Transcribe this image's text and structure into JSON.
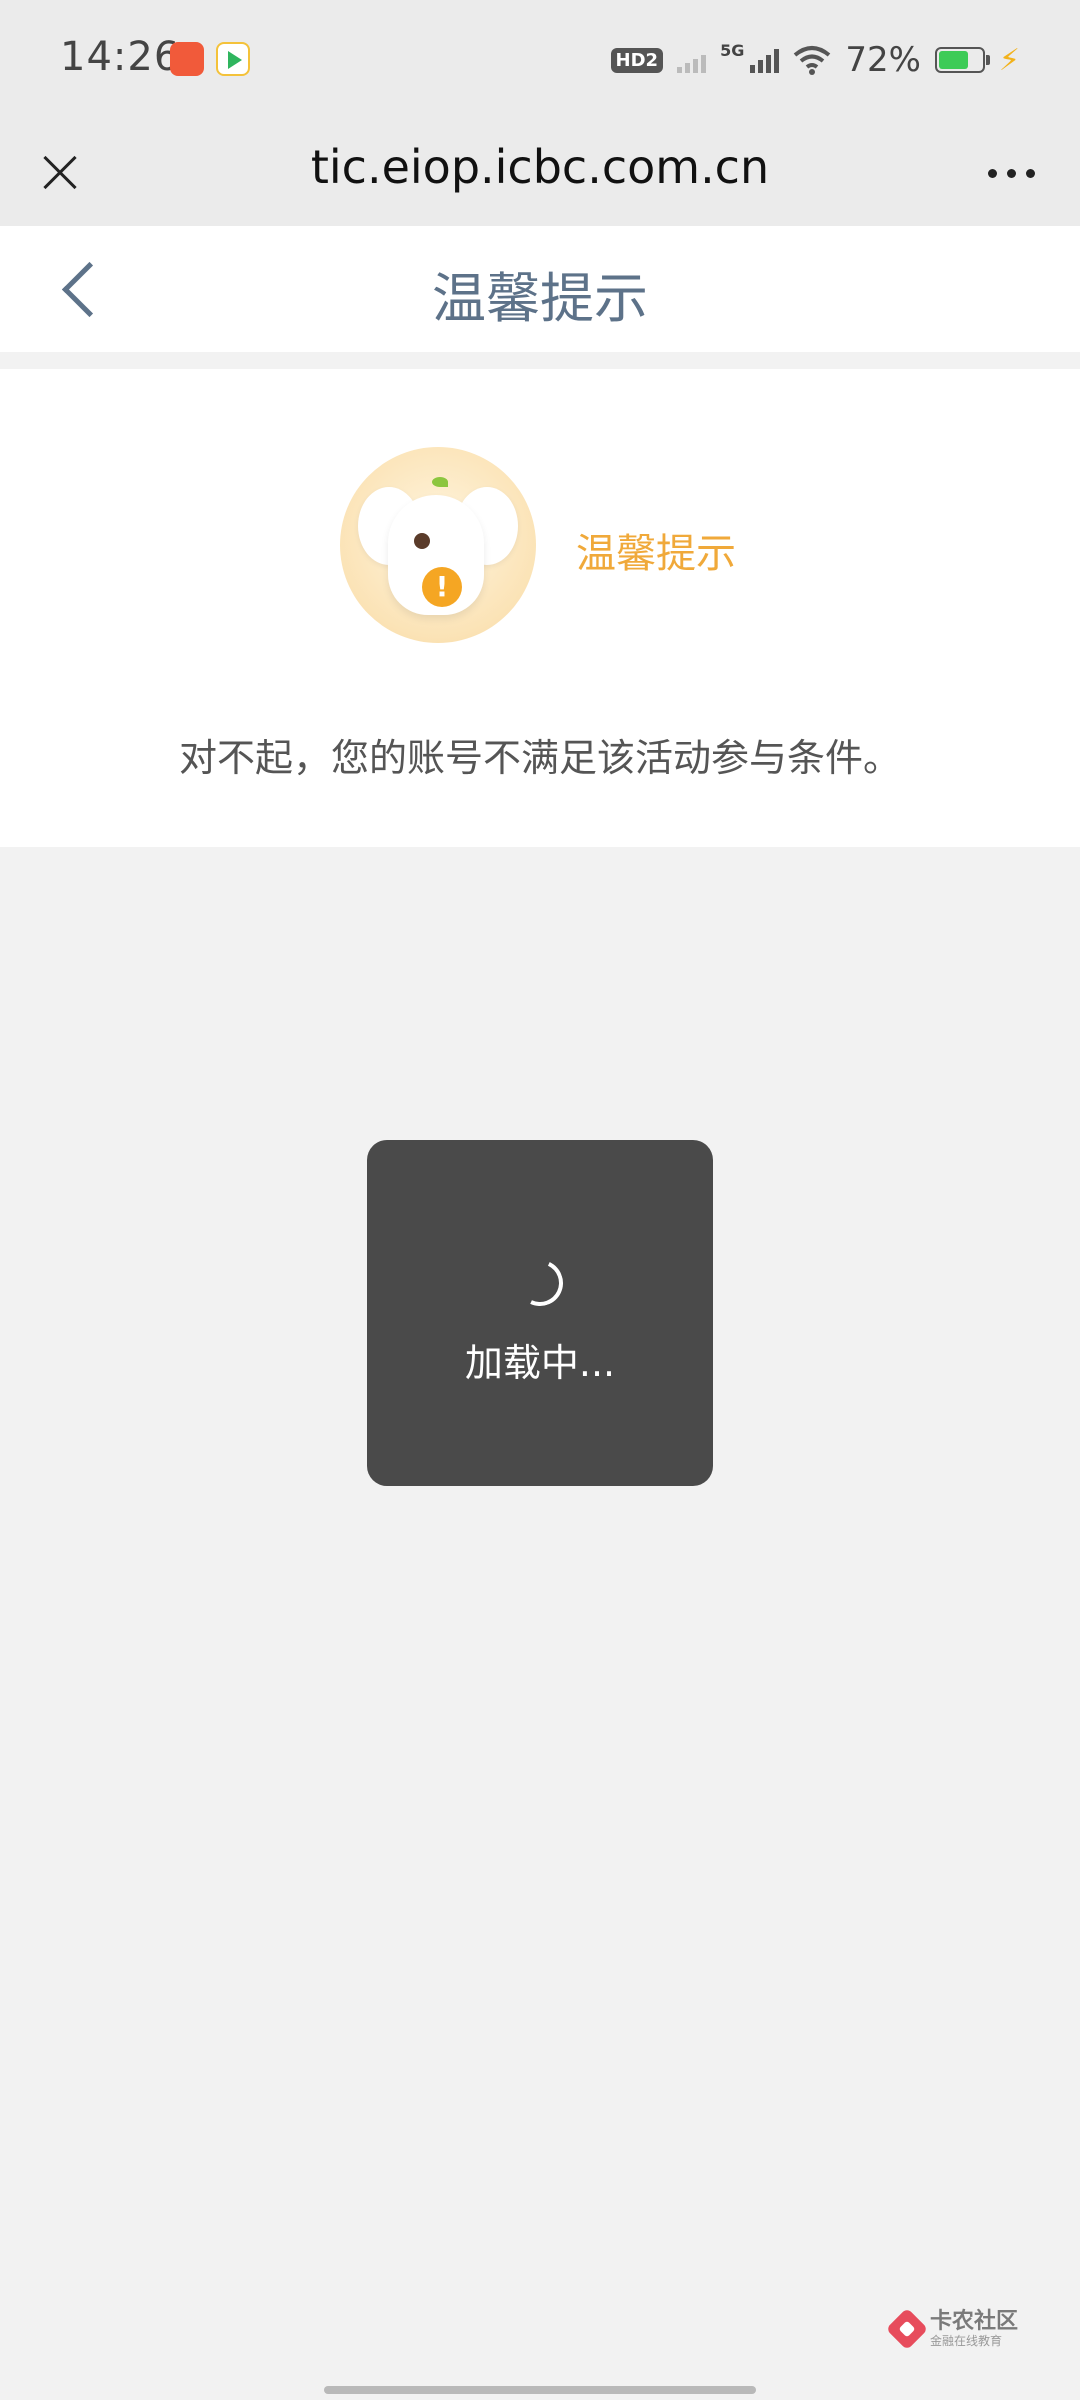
{
  "status_bar": {
    "time": "14:26",
    "hd_label": "HD2",
    "network_label": "5G",
    "battery_percent": "72%",
    "battery_level": 0.72,
    "icons": [
      "app-notification-icon",
      "video-app-icon",
      "hd-voice-icon",
      "signal-icon",
      "wifi-icon",
      "battery-icon",
      "charging-icon"
    ]
  },
  "browser": {
    "url": "tic.eiop.icbc.com.cn",
    "close_icon": "close-icon",
    "more_icon": "more-icon"
  },
  "header": {
    "title": "温馨提示",
    "back_icon": "chevron-left-icon"
  },
  "tip": {
    "heading": "温馨提示",
    "message": "对不起，您的账号不满足该活动参与条件。",
    "mascot_icon": "elephant-mascot-icon",
    "heading_color": "#f0a93a"
  },
  "loading": {
    "text": "加载中..."
  },
  "watermark": {
    "title": "卡农社区",
    "subtitle": "金融在线教育"
  }
}
